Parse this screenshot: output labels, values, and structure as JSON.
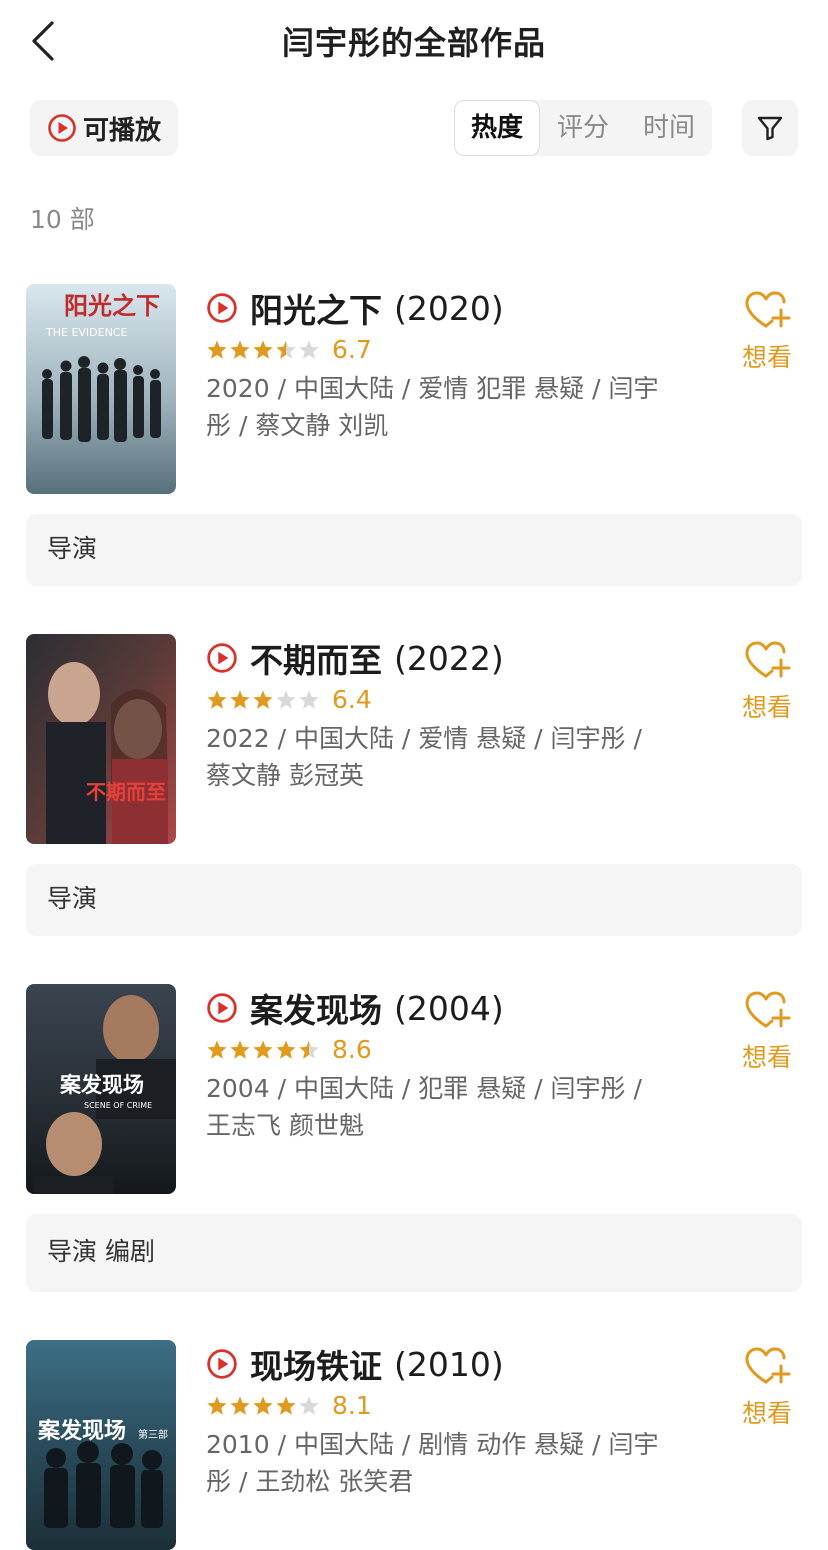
{
  "header": {
    "title": "闫宇彤的全部作品"
  },
  "toolbar": {
    "playable_label": "可播放",
    "sort_tabs": [
      "热度",
      "评分",
      "时间"
    ],
    "active_sort": "热度"
  },
  "count": "10 部",
  "colors": {
    "accent": "#e09a1e",
    "play_red": "#d8322c",
    "star_gray": "#d9d9d9"
  },
  "items": [
    {
      "title": "阳光之下",
      "year": "(2020)",
      "rating": 3.5,
      "score": "6.7",
      "meta_line1": "2020 / 中国大陆 / 爱情 犯罪 悬疑 / 闫宇",
      "meta_line2": "彤 / 蔡文静 刘凯",
      "wish_label": "想看",
      "roles": "导演",
      "poster_title": "阳光之下",
      "poster_subtitle": "THE EVIDENCE"
    },
    {
      "title": "不期而至",
      "year": "(2022)",
      "rating": 3,
      "score": "6.4",
      "meta_line1": "2022 / 中国大陆 / 爱情 悬疑 / 闫宇彤 /",
      "meta_line2": "蔡文静 彭冠英",
      "wish_label": "想看",
      "roles": "导演",
      "poster_title": "不期而至",
      "poster_subtitle": ""
    },
    {
      "title": "案发现场",
      "year": "(2004)",
      "rating": 4.5,
      "score": "8.6",
      "meta_line1": "2004 / 中国大陆 / 犯罪 悬疑 / 闫宇彤 /",
      "meta_line2": "王志飞 颜世魁",
      "wish_label": "想看",
      "roles": "导演 编剧",
      "poster_title": "案发现场",
      "poster_subtitle": "SCENE OF CRIME"
    },
    {
      "title": "现场铁证",
      "year": "(2010)",
      "rating": 4,
      "score": "8.1",
      "meta_line1": "2010 / 中国大陆 / 剧情 动作 悬疑 / 闫宇",
      "meta_line2": "彤 / 王劲松 张笑君",
      "wish_label": "想看",
      "roles": "",
      "poster_title": "案发现场",
      "poster_subtitle": "第三部"
    }
  ]
}
